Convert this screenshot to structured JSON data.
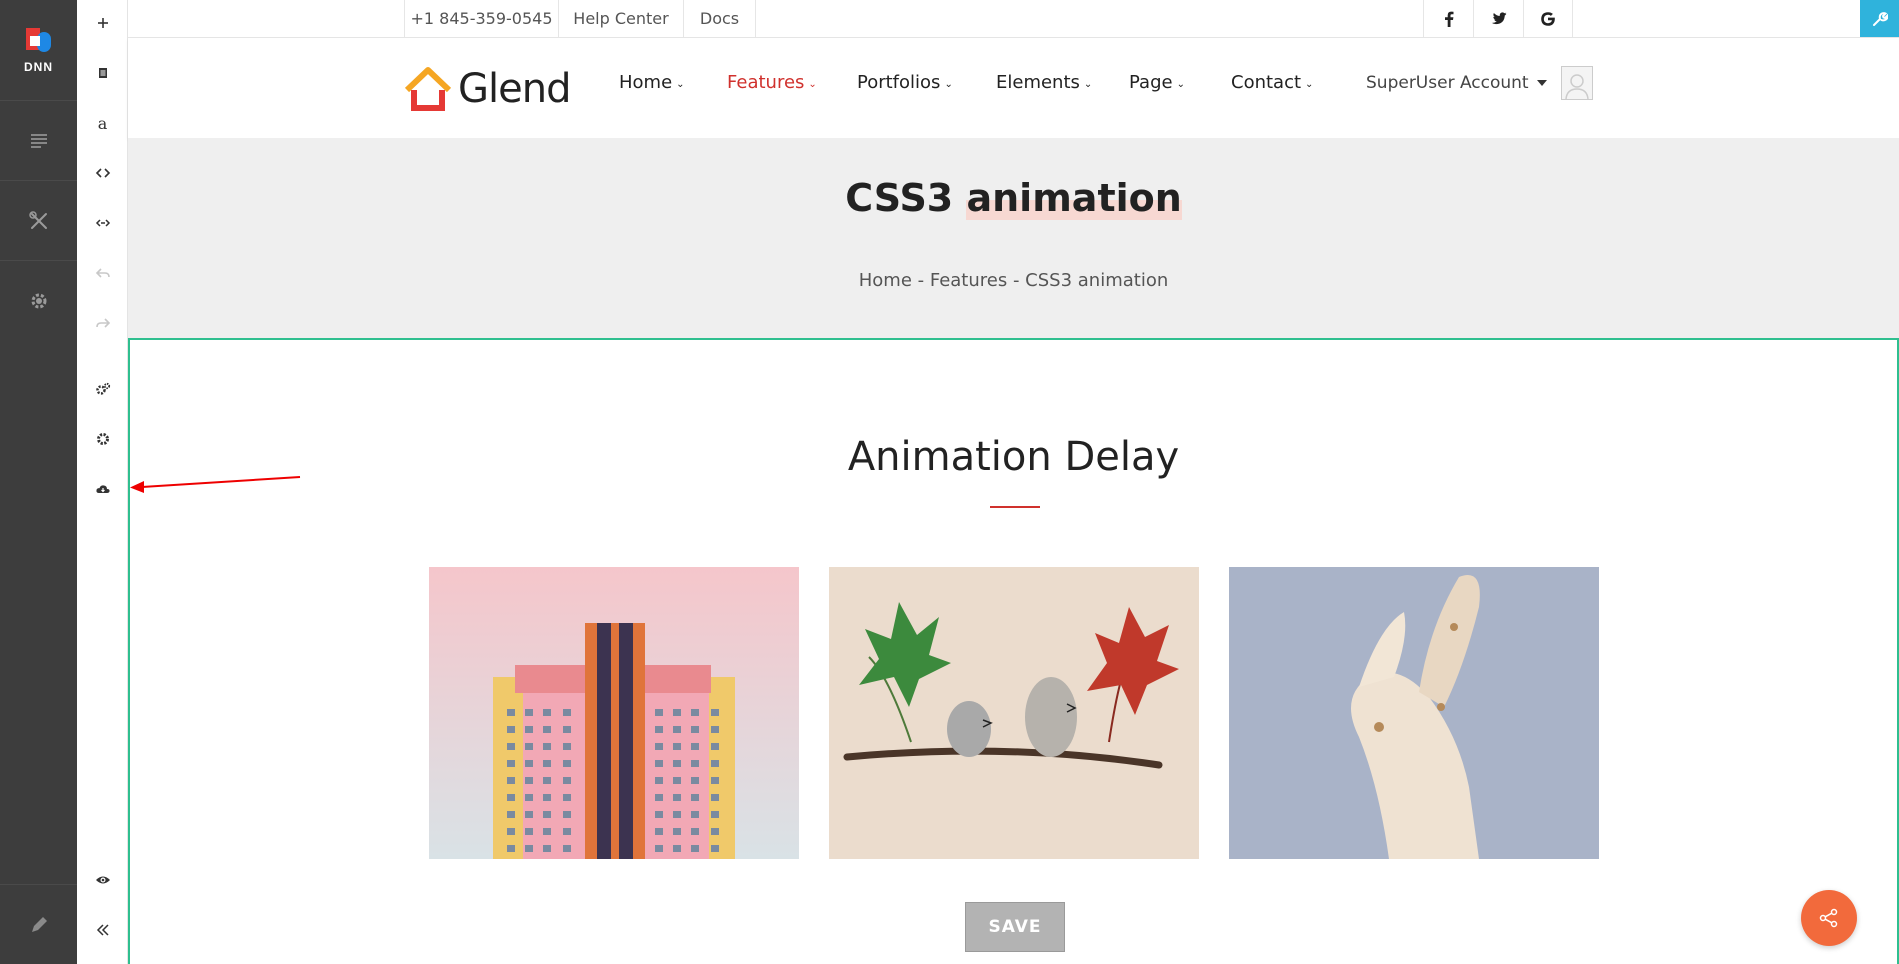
{
  "persona_bar": {
    "logo_text": "DNN",
    "items": [
      "content-icon",
      "tools-icon",
      "settings-icon"
    ],
    "bottom_icon": "pencil-icon"
  },
  "edit_bar": {
    "tools": [
      "add-icon",
      "module-icon",
      "text-icon",
      "code-icon",
      "embed-icon",
      "undo-icon",
      "redo-icon",
      "page-settings-icon",
      "settings-icon",
      "cloud-download-icon"
    ],
    "bottom_tools": [
      "eye-icon",
      "collapse-icon"
    ]
  },
  "topbar": {
    "phone": "+1 845-359-0545",
    "help": "Help Center",
    "docs": "Docs",
    "social": [
      "facebook-icon",
      "twitter-icon",
      "google-icon"
    ]
  },
  "header": {
    "brand": "Glend",
    "nav": [
      {
        "label": "Home",
        "active": false
      },
      {
        "label": "Features",
        "active": true
      },
      {
        "label": "Portfolios",
        "active": false
      },
      {
        "label": "Elements",
        "active": false
      },
      {
        "label": "Page",
        "active": false
      },
      {
        "label": "Contact",
        "active": false
      }
    ],
    "account": "SuperUser Account"
  },
  "page": {
    "title_a": "CSS3 ",
    "title_b": "animation",
    "breadcrumb": "Home - Features - CSS3 animation"
  },
  "content": {
    "heading": "Animation Delay",
    "images": [
      "pink-building-photo",
      "pebble-birds-leaves-photo",
      "wooden-figure-photo"
    ],
    "save_label": "SAVE"
  },
  "colors": {
    "accent": "#d0312d",
    "pane_border": "#2fbf8f",
    "persona_bg": "#3d3d3d",
    "share_bg": "#f26a3c",
    "wrench_bg": "#2fb3dc"
  }
}
